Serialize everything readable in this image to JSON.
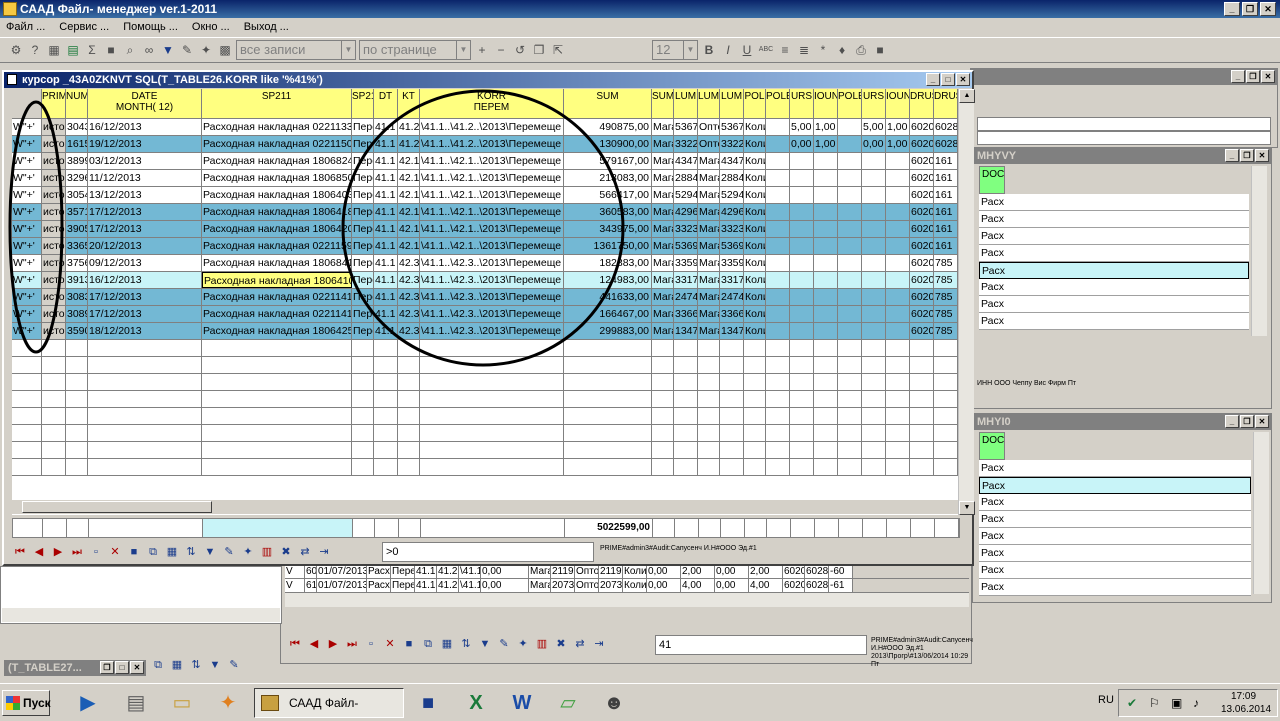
{
  "window": {
    "title": "САAД Файл- менеджер ver.1-2011",
    "btn_min": "_",
    "btn_restore": "❐",
    "btn_close": "✕"
  },
  "menu": [
    "Файл ...",
    "Сервис ...",
    "Помощь ...",
    "Окно ...",
    "Выход ..."
  ],
  "toolbar": {
    "filter_combo": "все записи",
    "page_combo": "по странице",
    "font_size": "12",
    "bold": "B",
    "italic": "I",
    "underline": "U",
    "abc": "ABC"
  },
  "main_panel": {
    "title": "курсор _43A0ZKNVT SQL(T_TABLE26.KORR like '%41%')",
    "columns": [
      "",
      "PRIM",
      "NUM",
      "DATE\nMONTH( 12)",
      "SP211",
      "SP21",
      "DT",
      "KT",
      "KORR\nПЕРЕМ",
      "SUM",
      "SUM",
      "LUM",
      "LUM",
      "LUM",
      "POL",
      "POLE",
      "URS",
      "IOUN",
      "POLE",
      "URS",
      "IOUN",
      "DRUS",
      "DRUS"
    ],
    "rows": [
      [
        "W\"+'",
        "исто",
        "3043",
        "16/12/2013",
        "Расходная накладная 0221133",
        "Пере",
        "41.1",
        "41.2",
        "\\41.1..\\41.2..\\2013\\Перемеще",
        "490875,00",
        "Мага",
        "5367",
        "Опто",
        "5367",
        "Коли",
        "",
        "5,00",
        "1,00",
        "",
        "5,00",
        "1,00",
        "6020",
        "6028"
      ],
      [
        "W\"+'",
        "исто",
        "1615",
        "19/12/2013",
        "Расходная накладная 0221150",
        "Пере",
        "41.1",
        "41.2",
        "\\41.1..\\41.2..\\2013\\Перемеще",
        "130900,00",
        "Мага",
        "3322",
        "Опто",
        "3322",
        "Коли",
        "",
        "0,00",
        "1,00",
        "",
        "0,00",
        "1,00",
        "6020",
        "6028"
      ],
      [
        "W\"+'",
        "исто",
        "3899",
        "03/12/2013",
        "Расходная накладная 1806824",
        "Пере",
        "41.1",
        "42.1",
        "\\41.1..\\42.1..\\2013\\Перемеще",
        "579167,00",
        "Мага",
        "4347",
        "Мага",
        "4347",
        "Коли",
        "",
        "",
        "",
        "",
        "",
        "",
        "6020",
        "161"
      ],
      [
        "W\"+'",
        "исто",
        "3296",
        "11/12/2013",
        "Расходная накладная 1806850",
        "Пере",
        "41.1",
        "42.1",
        "\\41.1..\\42.1..\\2013\\Перемеще",
        "213083,00",
        "Мага",
        "2884",
        "Мага",
        "2884",
        "Коли",
        "",
        "",
        "",
        "",
        "",
        "",
        "6020",
        "161"
      ],
      [
        "W\"+'",
        "исто",
        "3054",
        "13/12/2013",
        "Расходная накладная 1806403",
        "Пере",
        "41.1",
        "42.1",
        "\\41.1..\\42.1..\\2013\\Перемеще",
        "566417,00",
        "Мага",
        "5294",
        "Мага",
        "5294",
        "Коли",
        "",
        "",
        "",
        "",
        "",
        "",
        "6020",
        "161"
      ],
      [
        "W\"+'",
        "исто",
        "3571",
        "17/12/2013",
        "Расходная накладная 1806418",
        "Пере",
        "41.1",
        "42.1",
        "\\41.1..\\42.1..\\2013\\Перемеще",
        "360583,00",
        "Мага",
        "4296",
        "Мага",
        "4296",
        "Коли",
        "",
        "",
        "",
        "",
        "",
        "",
        "6020",
        "161"
      ],
      [
        "W\"+'",
        "исто",
        "3905",
        "17/12/2013",
        "Расходная накладная 1806420",
        "Пере",
        "41.1",
        "42.1",
        "\\41.1..\\42.1..\\2013\\Перемеще",
        "343975,00",
        "Мага",
        "3323",
        "Мага",
        "3323",
        "Коли",
        "",
        "",
        "",
        "",
        "",
        "",
        "6020",
        "161"
      ],
      [
        "W\"+'",
        "исто",
        "3365",
        "20/12/2013",
        "Расходная накладная 0221159",
        "Пере",
        "41.1",
        "42.1",
        "\\41.1..\\42.1..\\2013\\Перемеще",
        "1361750,00",
        "Мага",
        "5369",
        "Мага",
        "5369",
        "Коли",
        "",
        "",
        "",
        "",
        "",
        "",
        "6020",
        "161"
      ],
      [
        "W\"+'",
        "исто",
        "3756",
        "09/12/2013",
        "Расходная накладная 1806841",
        "Пере",
        "41.1",
        "42.3",
        "\\41.1..\\42.3..\\2013\\Перемеще",
        "182883,00",
        "Мага",
        "3359",
        "Мага",
        "3359",
        "Коли",
        "",
        "",
        "",
        "",
        "",
        "",
        "6020",
        "785"
      ],
      [
        "W\"+'",
        "исто",
        "3913",
        "16/12/2013",
        "Расходная накладная 1806410",
        "Пере",
        "41.1",
        "42.3",
        "\\41.1..\\42.3..\\2013\\Перемеще",
        "124983,00",
        "Мага",
        "3317",
        "Мага",
        "3317",
        "Коли",
        "",
        "",
        "",
        "",
        "",
        "",
        "6020",
        "785"
      ],
      [
        "W\"+'",
        "исто",
        "3083",
        "17/12/2013",
        "Расходная накладная 0221141",
        "Пере",
        "41.1",
        "42.3",
        "\\41.1..\\42.3..\\2013\\Перемеще",
        "441633,00",
        "Мага",
        "2474",
        "Мага",
        "2474",
        "Коли",
        "",
        "",
        "",
        "",
        "",
        "",
        "6020",
        "785"
      ],
      [
        "W\"+'",
        "исто",
        "3089",
        "17/12/2013",
        "Расходная накладная 0221141",
        "Пере",
        "41.1",
        "42.3",
        "\\41.1..\\42.3..\\2013\\Перемеще",
        "166467,00",
        "Мага",
        "3366",
        "Мага",
        "3366",
        "Коли",
        "",
        "",
        "",
        "",
        "",
        "",
        "6020",
        "785"
      ],
      [
        "W\"+'",
        "исто",
        "3590",
        "18/12/2013",
        "Расходная накладная 1806425",
        "Пере",
        "41.1",
        "42.3",
        "\\41.1..\\42.3..\\2013\\Перемеще",
        "299883,00",
        "Мага",
        "1347",
        "Мага",
        "1347",
        "Коли",
        "",
        "",
        "",
        "",
        "",
        "",
        "6020",
        "785"
      ]
    ],
    "total": "5022599,00",
    "filter_value": ">0",
    "status_line": "PRIME#admin3#Audit:Сапусенч И.Н#ООО          Эд.#1"
  },
  "right_panel_a": {
    "title": "МHYVY",
    "col": "DOC",
    "cells": [
      "Расх",
      "Расх",
      "Расх",
      "Расх",
      "Расх",
      "Расх",
      "Расх",
      "Расх"
    ],
    "info": "ИНН ООО Чеппу Вис Фирм Пт"
  },
  "right_panel_b": {
    "title": "МHYI0",
    "col": "DOC",
    "cells": [
      "Расх",
      "Расх",
      "Расх",
      "Расх",
      "Расх",
      "Расх",
      "Расх",
      "Расх",
      "Расх"
    ]
  },
  "bottom_panel": {
    "rows": [
      [
        "V",
        "60",
        "01/07/2013",
        "Расх",
        "Пере",
        "41.1",
        "41.2",
        "\\41.1",
        "0,00",
        "Мага",
        "2119",
        "Опто",
        "2119",
        "Коли",
        "0,00",
        "2,00",
        "0,00",
        "2,00",
        "6020",
        "6028",
        "-60"
      ],
      [
        "V",
        "61",
        "01/07/2013",
        "Расх",
        "Пере",
        "41.1",
        "41.2",
        "\\41.1",
        "0,00",
        "Мага",
        "2073",
        "Опто",
        "2073",
        "Коли",
        "0,00",
        "4,00",
        "0,00",
        "4,00",
        "6020",
        "6028",
        "-61"
      ]
    ],
    "filter_value": "41",
    "status_line": "PRIME#admin3#Audit:Сапусенч И.Н#ООО          Эд.#1",
    "status_line2": "2013\\Прогр\\#13/06/2014 10:29 Пт"
  },
  "minimized": {
    "title": "(T_TABLE27..."
  },
  "taskbar": {
    "start": "Пуск",
    "active_app": "САAД Файл- менед...",
    "lang": "RU",
    "time": "17:09",
    "date": "13.06.2014"
  }
}
